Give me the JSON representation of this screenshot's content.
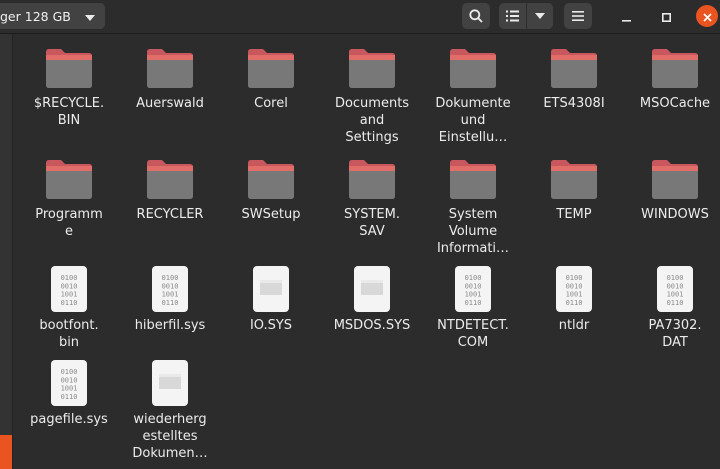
{
  "header": {
    "location_label": "ger 128 GB",
    "icons": [
      "chevron-down-icon",
      "search-icon",
      "list-view-icon",
      "chevron-down-icon",
      "menu-icon",
      "minimize-icon",
      "maximize-icon",
      "close-icon"
    ],
    "close_color": "#e95420"
  },
  "colors": {
    "background": "#2c2c2c",
    "folder_top": "#c9585e",
    "folder_body": "#787878",
    "accent": "#e95420"
  },
  "files": [
    {
      "label": "$RECYCLE.\nBIN",
      "type": "folder"
    },
    {
      "label": "Auerswald",
      "type": "folder"
    },
    {
      "label": "Corel",
      "type": "folder"
    },
    {
      "label": "Documents\nand\nSettings",
      "type": "folder"
    },
    {
      "label": "Dokumente\nund\nEinstellu…",
      "type": "folder"
    },
    {
      "label": "ETS4308I",
      "type": "folder"
    },
    {
      "label": "MSOCache",
      "type": "folder"
    },
    {
      "label": "Programm\ne",
      "type": "folder"
    },
    {
      "label": "RECYCLER",
      "type": "folder"
    },
    {
      "label": "SWSetup",
      "type": "folder"
    },
    {
      "label": "SYSTEM.\nSAV",
      "type": "folder"
    },
    {
      "label": "System\nVolume\nInformati…",
      "type": "folder"
    },
    {
      "label": "TEMP",
      "type": "folder"
    },
    {
      "label": "WINDOWS",
      "type": "folder"
    },
    {
      "label": "bootfont.\nbin",
      "type": "binary"
    },
    {
      "label": "hiberfil.sys",
      "type": "binary"
    },
    {
      "label": "IO.SYS",
      "type": "document"
    },
    {
      "label": "MSDOS.SYS",
      "type": "document"
    },
    {
      "label": "NTDETECT.\nCOM",
      "type": "binary"
    },
    {
      "label": "ntldr",
      "type": "binary"
    },
    {
      "label": "PA7302.\nDAT",
      "type": "binary"
    },
    {
      "label": "pagefile.sys",
      "type": "binary"
    },
    {
      "label": "wiederherg\nestelltes\nDokumen…",
      "type": "document"
    }
  ]
}
